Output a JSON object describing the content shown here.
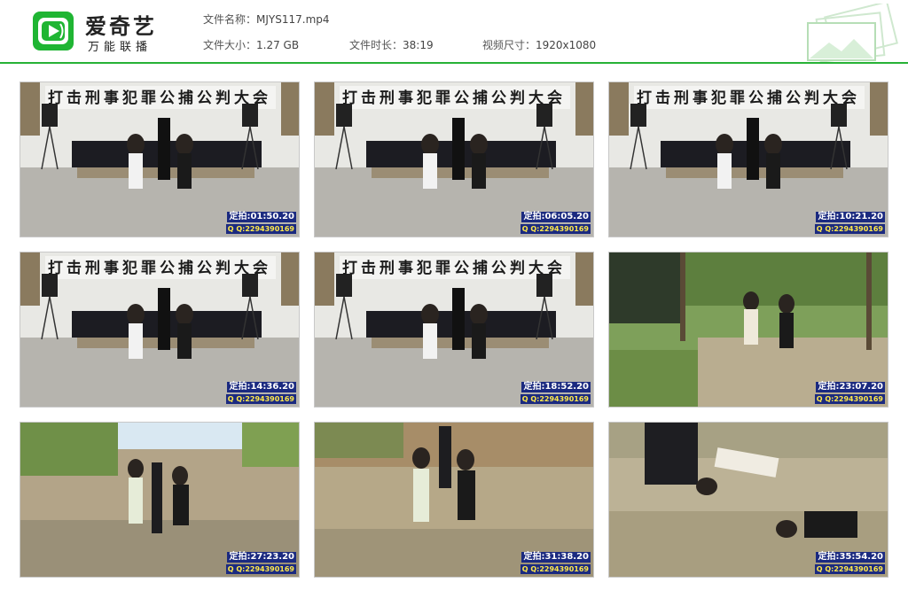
{
  "app": {
    "brand_name": "爱奇艺",
    "brand_sub": "万能联播"
  },
  "file": {
    "name_label": "文件名称：",
    "name_value": "MJYS117.mp4",
    "size_label": "文件大小：",
    "size_value": "1.27 GB",
    "duration_label": "文件时长：",
    "duration_value": "38:19",
    "dimensions_label": "视频尺寸：",
    "dimensions_value": "1920x1080"
  },
  "colors": {
    "accent": "#27b236",
    "timestamp_bg": "#1b2a80"
  },
  "thumbnails": [
    {
      "scene": "stage",
      "banner": "打击刑事犯罪公捕公判大会",
      "timestamp": "01:50",
      "ts_full": "定拍:01:50.20",
      "qq": "Q Q:2294390169"
    },
    {
      "scene": "stage",
      "banner": "打击刑事犯罪公捕公判大会",
      "timestamp": "06:05",
      "ts_full": "定拍:06:05.20",
      "qq": "Q Q:2294390169"
    },
    {
      "scene": "stage",
      "banner": "打击刑事犯罪公捕公判大会",
      "timestamp": "10:21",
      "ts_full": "定拍:10:21.20",
      "qq": "Q Q:2294390169"
    },
    {
      "scene": "stage",
      "banner": "打击刑事犯罪公捕公判大会",
      "timestamp": "14:36",
      "ts_full": "定拍:14:36.20",
      "qq": "Q Q:2294390169"
    },
    {
      "scene": "stage",
      "banner": "打击刑事犯罪公捕公判大会",
      "timestamp": "18:52",
      "ts_full": "定拍:18:52.20",
      "qq": "Q Q:2294390169"
    },
    {
      "scene": "forest",
      "banner": "",
      "timestamp": "23:07",
      "ts_full": "定拍:23:07.20",
      "qq": "Q Q:2294390169"
    },
    {
      "scene": "hill",
      "banner": "",
      "timestamp": "27:23",
      "ts_full": "定拍:27:23.20",
      "qq": "Q Q:2294390169"
    },
    {
      "scene": "dirt",
      "banner": "",
      "timestamp": "31:38",
      "ts_full": "定拍:31:38.20",
      "qq": "Q Q:2294390169"
    },
    {
      "scene": "ground",
      "banner": "",
      "timestamp": "35:54",
      "ts_full": "定拍:35:54.20",
      "qq": "Q Q:2294390169"
    }
  ]
}
